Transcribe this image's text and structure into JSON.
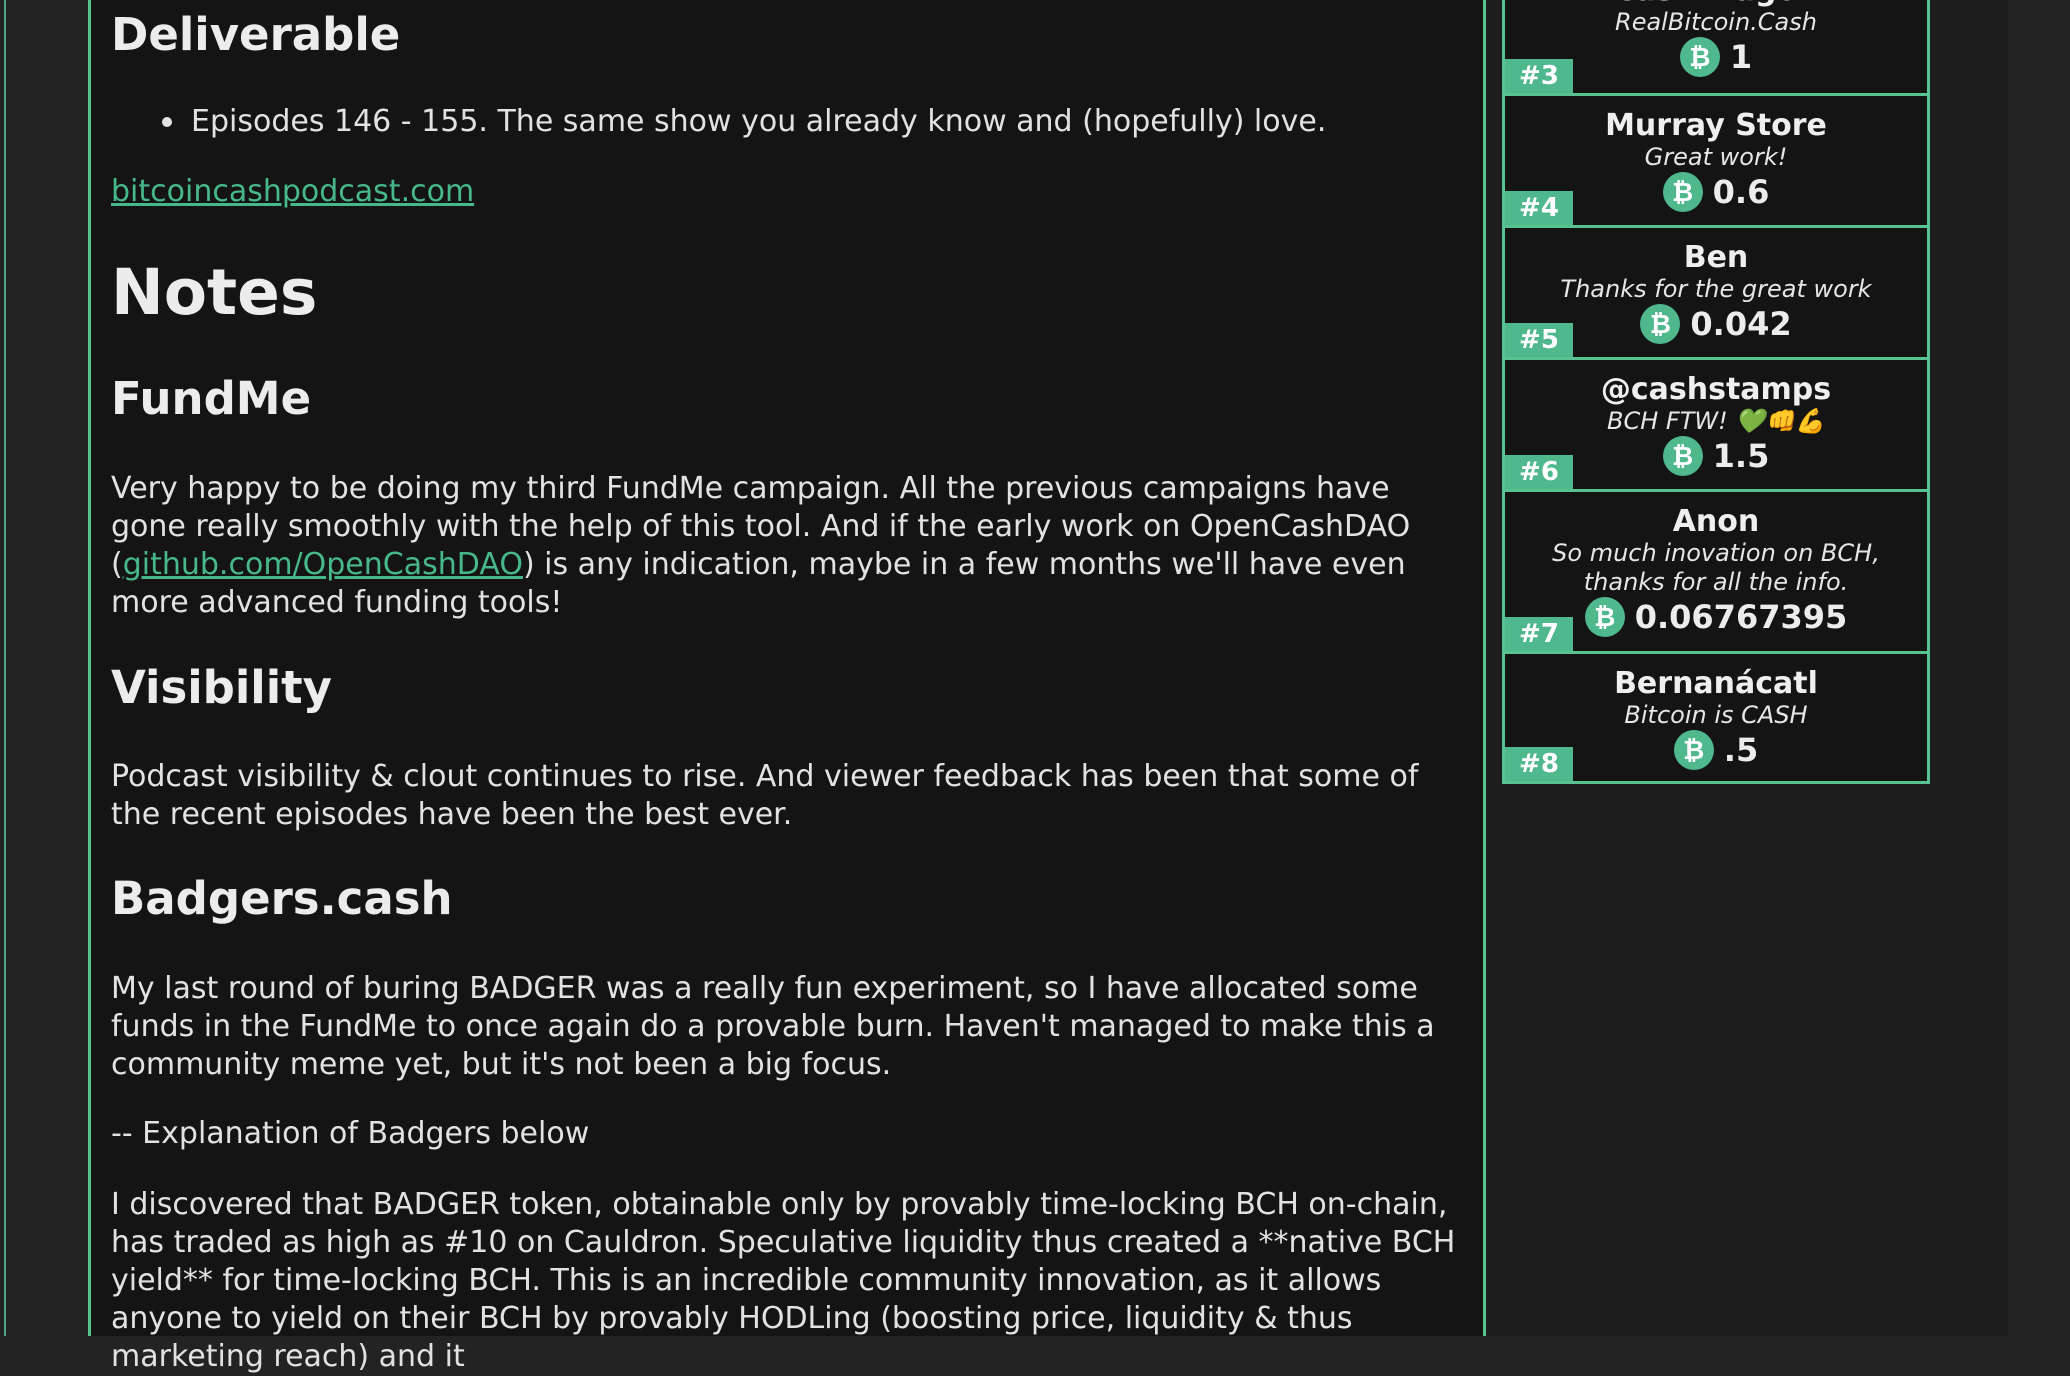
{
  "deliverable": {
    "heading": "Deliverable",
    "bullet": "Episodes 146 - 155. The same show you already know and (hopefully) love.",
    "link": "bitcoincashpodcast.com"
  },
  "notes": {
    "heading": "Notes",
    "fundme": {
      "heading": "FundMe",
      "text_before": "Very happy to be doing my third FundMe campaign. All the previous campaigns have gone really smoothly with the help of this tool. And if the early work on OpenCashDAO (",
      "link": "github.com/OpenCashDAO",
      "text_after": ") is any indication, maybe in a few months we'll have even more advanced funding tools!"
    },
    "visibility": {
      "heading": "Visibility",
      "text": "Podcast visibility & clout continues to rise. And viewer feedback has been that some of the recent episodes have been the best ever."
    },
    "badgers": {
      "heading": "Badgers.cash",
      "paragraph1": "My last round of buring BADGER was a really fun experiment, so I have allocated some funds in the FundMe to once again do a provable burn. Haven't managed to make this a community meme yet, but it's not been a big focus.",
      "paragraph2": "-- Explanation of Badgers below",
      "paragraph3": "I discovered that BADGER token, obtainable only by provably time-locking BCH on-chain, has traded as high as #10 on Cauldron. Speculative liquidity thus created a **native BCH yield** for time-locking BCH. This is an incredible community innovation, as it allows anyone to yield on their BCH by provably HODLing (boosting price, liquidity & thus marketing reach) and it"
    }
  },
  "donors": [
    {
      "rank": "#3",
      "name": "CashDragon",
      "message": "RealBitcoin.Cash",
      "amount": "1"
    },
    {
      "rank": "#4",
      "name": "Murray Store",
      "message": "Great work!",
      "amount": "0.6"
    },
    {
      "rank": "#5",
      "name": "Ben",
      "message": "Thanks for the great work",
      "amount": "0.042"
    },
    {
      "rank": "#6",
      "name": "@cashstamps",
      "message": "BCH FTW! 💚👊💪",
      "amount": "1.5"
    },
    {
      "rank": "#7",
      "name": "Anon",
      "message": "So much inovation on BCH, thanks for all the info.",
      "amount": "0.06767395"
    },
    {
      "rank": "#8",
      "name": "Bernanácatl",
      "message": "Bitcoin is CASH",
      "amount": ".5"
    }
  ],
  "icons": {
    "currency": "bitcoin-icon",
    "currency_glyph": "₿"
  },
  "colors": {
    "accent": "#59c291",
    "background": "#141414",
    "link": "#47b88a"
  }
}
